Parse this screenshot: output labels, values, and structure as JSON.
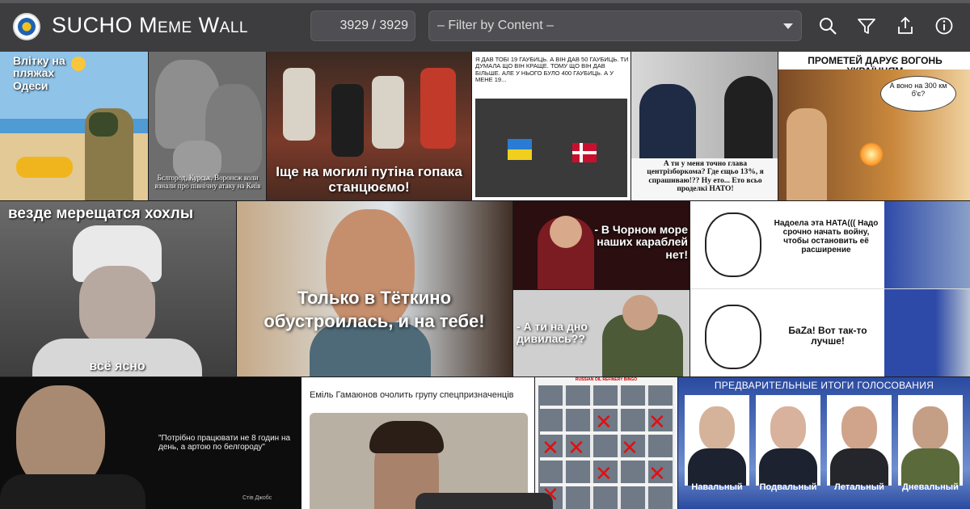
{
  "app": {
    "title": "SUCHO Meme Wall",
    "counter": "3929 / 3929",
    "filter_placeholder": "– Filter by Content –"
  },
  "toolbar": {
    "icons": [
      "search-icon",
      "filter-icon",
      "share-icon",
      "info-icon"
    ]
  },
  "memes": {
    "m1": {
      "text": "Влітку на пляжах Одеси"
    },
    "m2": {
      "text": "Бєлгород, Курськ, Воронєж коли взнали про північну атаку на Київ"
    },
    "m3": {
      "text": "Іще на могилі путіна гопака станцюємо!"
    },
    "m4": {
      "text": "Я ДАВ ТОБІ 19 ГАУБИЦЬ. А ВІН ДАВ 50 ГАУБИЦЬ. ТИ ДУМАЛА ЩО ВІН КРАЩЕ. ТОМУ ЩО ВІН ДАВ БІЛЬШЕ. АЛЕ У НЬОГО БУЛО 400 ГАУБИЦЬ. А У МЕНЕ 19..."
    },
    "m5": {
      "text": "А ти у меня точно глава центрізборкома? Где єщьо 13%, я спрашиваю!?? Ну ето... Ето всьо проделкі НАТО!"
    },
    "m6": {
      "title": "ПРОМЕТЕЙ ДАРУЄ ВОГОНЬ УКРАЇНЦЯМ",
      "bubble": "А воно на 300 км б'є?"
    },
    "m7": {
      "top": "везде мерещатся хохлы",
      "bottom": "всё ясно"
    },
    "m8": {
      "text": "Только в Тёткино обустроилась, и на тебе!"
    },
    "m9": {
      "text": "- В Чорном море наших караблей нет!"
    },
    "m10": {
      "text": "- А ти на дно дивилась??"
    },
    "m11": {
      "top": "Надоела эта НАТА((( Надо срочно начать войну, чтобы остановить её расширение",
      "bottom": "БаZa! Вот так-то лучше!"
    },
    "m12": {
      "quote": "\"Потрібно працювати не 8 годин на день, а артою по белгороду\"",
      "author": "Стів Джобс"
    },
    "m13": {
      "text": "Еміль Гамаюнов очолить групу спецпризначенців"
    },
    "m14": {
      "title": "RUSSIAN OIL REFINERY BINGO"
    },
    "m15": {
      "title": "ПРЕДВАРИТЕЛЬНЫЕ ИТОГИ ГОЛОСОВАНИЯ",
      "names": [
        "Навальный",
        "Подвальный",
        "Летальный",
        "Дневальный"
      ]
    }
  },
  "colors": {
    "header_bg": "#3d3d40",
    "control_bg": "#4f4f53",
    "text": "#ffffff"
  }
}
